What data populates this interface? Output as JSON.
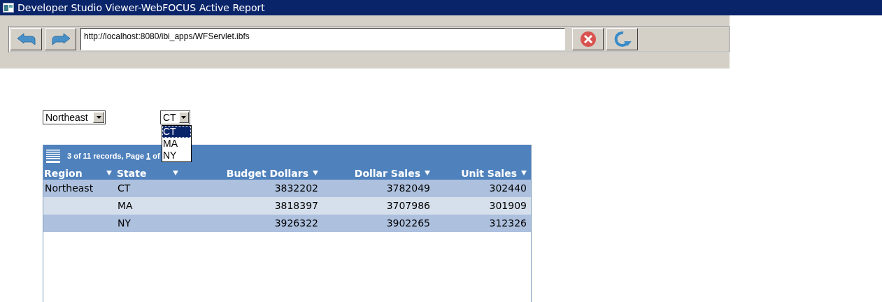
{
  "window": {
    "title": "Developer Studio Viewer-WebFOCUS Active Report"
  },
  "toolbar": {
    "address": "http://localhost:8080/ibi_apps/WFServlet.ibfs"
  },
  "filters": {
    "region": {
      "value": "Northeast"
    },
    "state": {
      "value": "CT",
      "expanded": true,
      "options": [
        {
          "label": "CT",
          "selected": true
        },
        {
          "label": "MA",
          "selected": false
        },
        {
          "label": "NY",
          "selected": false
        }
      ]
    }
  },
  "report": {
    "records_text": "3 of 11 records, Page",
    "page_link": "1",
    "page_suffix": "of",
    "columns": [
      {
        "label": "Region",
        "kind": "text"
      },
      {
        "label": "State",
        "kind": "text"
      },
      {
        "label": "Budget Dollars",
        "kind": "number"
      },
      {
        "label": "Dollar Sales",
        "kind": "number"
      },
      {
        "label": "Unit Sales",
        "kind": "number"
      }
    ],
    "rows": [
      [
        "Northeast",
        "CT",
        "3832202",
        "3782049",
        "302440"
      ],
      [
        "",
        "MA",
        "3818397",
        "3707986",
        "301909"
      ],
      [
        "",
        "NY",
        "3926322",
        "3902265",
        "312326"
      ]
    ]
  }
}
